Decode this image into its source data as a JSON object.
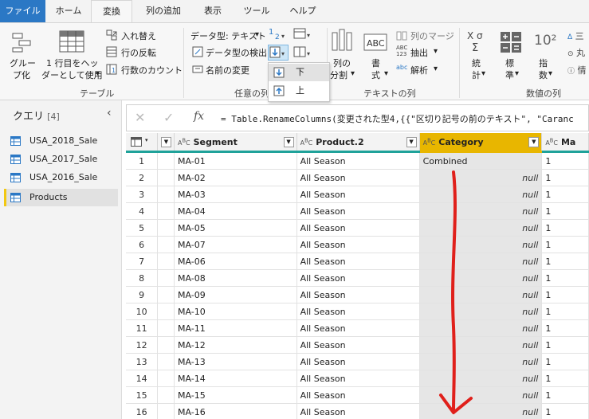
{
  "menu": {
    "tabs": [
      "ファイル",
      "ホーム",
      "変換",
      "列の追加",
      "表示",
      "ツール",
      "ヘルプ"
    ],
    "active": "変換"
  },
  "ribbon": {
    "table_group": {
      "label": "テーブル",
      "group_by": [
        "グルー",
        "プ化"
      ],
      "use_first_row": [
        "1 行目をヘッ",
        "ダーとして使用"
      ],
      "transpose": "入れ替え",
      "reverse_rows": "行の反転",
      "count_rows": "行数のカウント"
    },
    "any_column_group": {
      "label": "任意の列",
      "data_type": "データ型: テキスト",
      "detect_type": "データ型の検出",
      "rename": "名前の変更"
    },
    "text_column_group": {
      "label": "テキストの列",
      "split_column": [
        "列の",
        "分割"
      ],
      "format": [
        "書",
        "式"
      ],
      "merge_columns": "列のマージ",
      "extract": "抽出",
      "parse": "解析",
      "abc123": "ABC\n123"
    },
    "number_column_group": {
      "label": "数値の列",
      "statistics": [
        "統",
        "計"
      ],
      "standard": [
        "標",
        "準"
      ],
      "scientific": [
        "指",
        "数"
      ],
      "rounding_partial": "丸",
      "info_partial": "情",
      "trig_partial": "三",
      "ten_squared": "10²"
    }
  },
  "fill_dropdown": {
    "items": [
      "下",
      "上"
    ],
    "highlighted": "下"
  },
  "queries": {
    "title": "クエリ",
    "count": "[4]",
    "items": [
      "USA_2018_Sale",
      "USA_2017_Sale",
      "USA_2016_Sale",
      "Products"
    ],
    "selected": "Products"
  },
  "formula_bar": {
    "text": "= Table.RenameColumns(変更された型4,{{\"区切り記号の前のテキスト\", \"Caranc"
  },
  "grid": {
    "columns": [
      "Segment",
      "Product.2",
      "Category",
      "Ma"
    ],
    "rows": [
      {
        "n": "1",
        "segment": "MA-01",
        "product": "All Season",
        "category": "Combined",
        "m": "1"
      },
      {
        "n": "2",
        "segment": "MA-02",
        "product": "All Season",
        "category": "null",
        "m": "1"
      },
      {
        "n": "3",
        "segment": "MA-03",
        "product": "All Season",
        "category": "null",
        "m": "1"
      },
      {
        "n": "4",
        "segment": "MA-04",
        "product": "All Season",
        "category": "null",
        "m": "1"
      },
      {
        "n": "5",
        "segment": "MA-05",
        "product": "All Season",
        "category": "null",
        "m": "1"
      },
      {
        "n": "6",
        "segment": "MA-07",
        "product": "All Season",
        "category": "null",
        "m": "1"
      },
      {
        "n": "7",
        "segment": "MA-06",
        "product": "All Season",
        "category": "null",
        "m": "1"
      },
      {
        "n": "8",
        "segment": "MA-08",
        "product": "All Season",
        "category": "null",
        "m": "1"
      },
      {
        "n": "9",
        "segment": "MA-09",
        "product": "All Season",
        "category": "null",
        "m": "1"
      },
      {
        "n": "10",
        "segment": "MA-10",
        "product": "All Season",
        "category": "null",
        "m": "1"
      },
      {
        "n": "11",
        "segment": "MA-11",
        "product": "All Season",
        "category": "null",
        "m": "1"
      },
      {
        "n": "12",
        "segment": "MA-12",
        "product": "All Season",
        "category": "null",
        "m": "1"
      },
      {
        "n": "13",
        "segment": "MA-13",
        "product": "All Season",
        "category": "null",
        "m": "1"
      },
      {
        "n": "14",
        "segment": "MA-14",
        "product": "All Season",
        "category": "null",
        "m": "1"
      },
      {
        "n": "15",
        "segment": "MA-15",
        "product": "All Season",
        "category": "null",
        "m": "1"
      },
      {
        "n": "16",
        "segment": "MA-16",
        "product": "All Season",
        "category": "null",
        "m": "1"
      }
    ]
  },
  "colors": {
    "file_tab": "#2b78c5",
    "selected_column": "#e8b600",
    "column_quality_bar": "#1fa29a",
    "annotation_arrow": "#e0201b"
  }
}
